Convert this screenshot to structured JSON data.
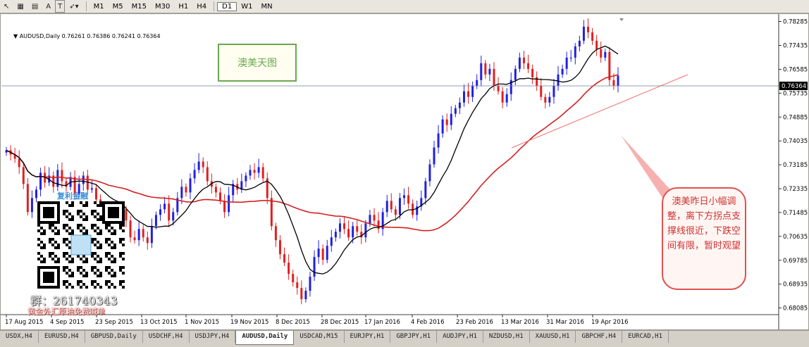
{
  "toolbar": {
    "buttons": [
      "A",
      "T"
    ],
    "timeframes": [
      "M1",
      "M5",
      "M15",
      "M30",
      "H1",
      "H4",
      "D1",
      "W1",
      "MN"
    ],
    "active_timeframe": "D1"
  },
  "chart_header": "AUDUSD,Daily  0.76261 0.76386 0.76241 0.76364",
  "title_box": "澳美天图",
  "note_text": "澳美昨日小幅调整，离下方拐点支撑线很近，下跌空间有限，暂时观望",
  "promo": {
    "brand": "复利金融",
    "group": "群：261740343",
    "slogan": "黄金外汇原油免费喊单"
  },
  "current_price_label": "0.76364",
  "tabs": [
    "USDX,H4",
    "EURUSD,H4",
    "GBPUSD,Daily",
    "USDCHF,H4",
    "USDJPY,H4",
    "AUDUSD,Daily",
    "USDCAD,M15",
    "EURJPY,H1",
    "GBPJPY,H1",
    "AUDJPY,H1",
    "NZDUSD,H1",
    "XAUUSD,H1",
    "GBPCHF,H4",
    "EURCAD,H1"
  ],
  "active_tab": "AUDUSD,Daily",
  "colors": {
    "bull": "#2020e0",
    "bear": "#e02020",
    "ma_fast": "#000000",
    "ma_slow": "#d42020",
    "trendline": "#f07070"
  },
  "chart_data": {
    "type": "candlestick",
    "symbol": "AUDUSD",
    "timeframe": "Daily",
    "last": {
      "open": 0.76261,
      "high": 0.76386,
      "low": 0.76241,
      "close": 0.76364
    },
    "ylim": [
      0.6785,
      0.7855
    ],
    "y_ticks": [
      "0.78285",
      "0.77435",
      "0.76585",
      "0.76364",
      "0.75735",
      "0.74885",
      "0.74035",
      "0.73185",
      "0.72335",
      "0.71485",
      "0.70635",
      "0.69785",
      "0.68935",
      "0.68085"
    ],
    "x_ticks": [
      "17 Aug 2015",
      "4 Sep 2015",
      "23 Sep 2015",
      "13 Oct 2015",
      "1 Nov 2015",
      "19 Nov 2015",
      "8 Dec 2015",
      "28 Dec 2015",
      "17 Jan 2016",
      "4 Feb 2016",
      "23 Feb 2016",
      "13 Mar 2016",
      "31 Mar 2016",
      "19 Apr 2016"
    ],
    "closes_approx": [
      0.737,
      0.7355,
      0.734,
      0.731,
      0.725,
      0.715,
      0.72,
      0.723,
      0.729,
      0.7255,
      0.728,
      0.724,
      0.73,
      0.726,
      0.724,
      0.7275,
      0.7215,
      0.725,
      0.728,
      0.723,
      0.7235,
      0.7195,
      0.715,
      0.713,
      0.71,
      0.717,
      0.714,
      0.716,
      0.712,
      0.706,
      0.705,
      0.709,
      0.706,
      0.704,
      0.71,
      0.714,
      0.716,
      0.718,
      0.712,
      0.715,
      0.72,
      0.724,
      0.722,
      0.727,
      0.73,
      0.733,
      0.731,
      0.726,
      0.724,
      0.722,
      0.719,
      0.715,
      0.721,
      0.725,
      0.723,
      0.726,
      0.728,
      0.73,
      0.729,
      0.731,
      0.727,
      0.72,
      0.71,
      0.705,
      0.7,
      0.697,
      0.693,
      0.69,
      0.688,
      0.684,
      0.687,
      0.692,
      0.699,
      0.702,
      0.698,
      0.703,
      0.706,
      0.708,
      0.711,
      0.709,
      0.706,
      0.71,
      0.708,
      0.706,
      0.711,
      0.714,
      0.712,
      0.709,
      0.715,
      0.719,
      0.716,
      0.714,
      0.72,
      0.721,
      0.718,
      0.714,
      0.717,
      0.72,
      0.726,
      0.732,
      0.738,
      0.743,
      0.748,
      0.746,
      0.75,
      0.752,
      0.754,
      0.758,
      0.756,
      0.76,
      0.762,
      0.768,
      0.764,
      0.766,
      0.76,
      0.758,
      0.754,
      0.757,
      0.762,
      0.766,
      0.77,
      0.768,
      0.766,
      0.763,
      0.76,
      0.756,
      0.754,
      0.756,
      0.76,
      0.764,
      0.766,
      0.77,
      0.77,
      0.774,
      0.776,
      0.781,
      0.779,
      0.776,
      0.773,
      0.77,
      0.772,
      0.762,
      0.76,
      0.7636
    ]
  }
}
